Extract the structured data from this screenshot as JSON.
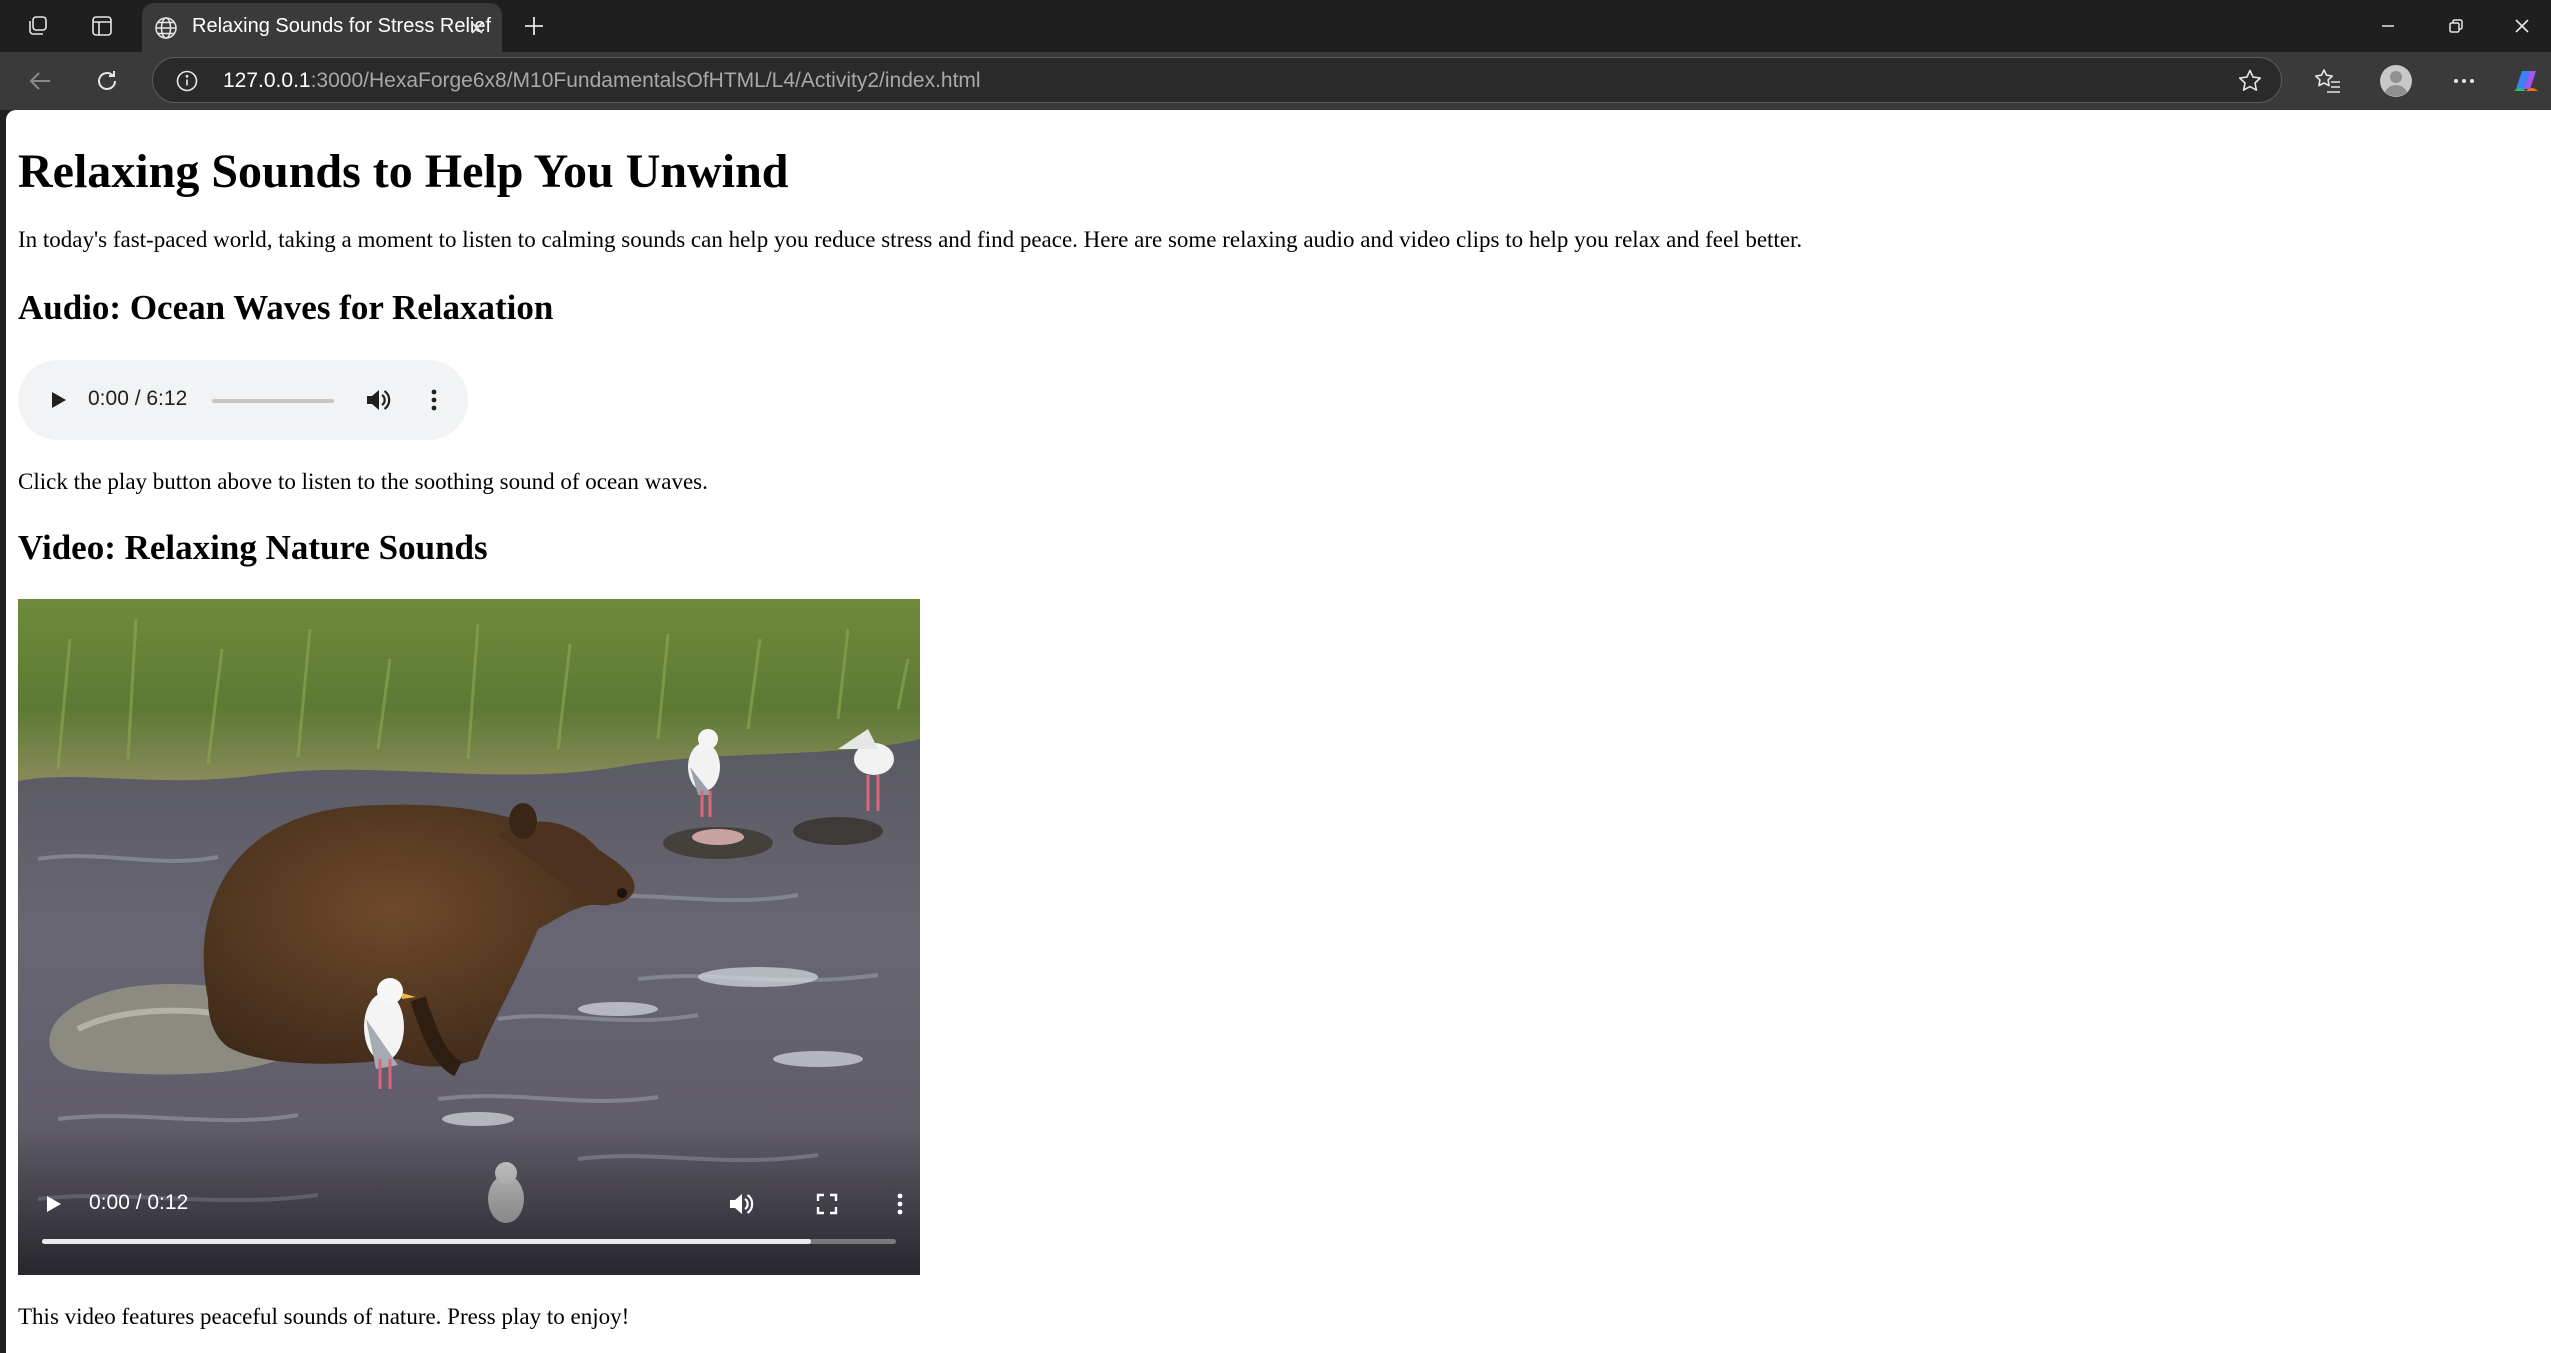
{
  "browser": {
    "tab": {
      "title": "Relaxing Sounds for Stress Relief"
    },
    "address_bar": {
      "host": "127.0.0.1",
      "path": ":3000/HexaForge6x8/M10FundamentalsOfHTML/L4/Activity2/index.html"
    }
  },
  "page": {
    "title": "Relaxing Sounds to Help You Unwind",
    "intro": "In today's fast-paced world, taking a moment to listen to calming sounds can help you reduce stress and find peace. Here are some relaxing audio and video clips to help you relax and feel better.",
    "audio_section": {
      "heading": "Audio: Ocean Waves for Relaxation",
      "player": {
        "time": "0:00 / 6:12"
      },
      "caption": "Click the play button above to listen to the soothing sound of ocean waves."
    },
    "video_section": {
      "heading": "Video: Relaxing Nature Sounds",
      "player": {
        "time": "0:00 / 0:12",
        "buffered_fraction": 0.9
      },
      "caption": "This video features peaceful sounds of nature. Press play to enjoy!"
    }
  }
}
